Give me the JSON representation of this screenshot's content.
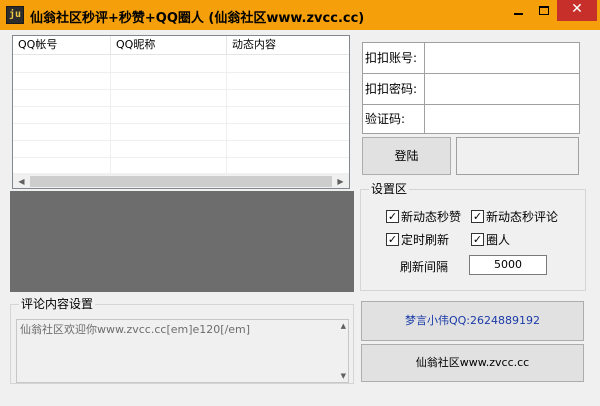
{
  "window": {
    "icon_text": "ju",
    "title": "仙翁社区秒评+秒赞+QQ圈人 (仙翁社区www.zvcc.cc)",
    "close_glyph": "✕"
  },
  "list": {
    "columns": [
      "QQ帐号",
      "QQ昵称",
      "动态内容"
    ],
    "rows": []
  },
  "comment_settings": {
    "group_title": "评论内容设置",
    "text": "仙翁社区欢迎你www.zvcc.cc[em]e120[/em]"
  },
  "login": {
    "account_label": "扣扣账号:",
    "password_label": "扣扣密码:",
    "captcha_label": "验证码:",
    "account_value": "",
    "password_value": "",
    "captcha_value": "",
    "login_button": "登陆"
  },
  "settings": {
    "group_title": "设置区",
    "options": [
      {
        "label": "新动态秒赞",
        "checked": true
      },
      {
        "label": "新动态秒评论",
        "checked": true
      },
      {
        "label": "定时刷新",
        "checked": true
      },
      {
        "label": "圈人",
        "checked": true
      }
    ],
    "interval_label": "刷新间隔",
    "interval_value": "5000"
  },
  "buttons": {
    "contact": "梦言小伟QQ:2624889192",
    "site": "仙翁社区www.zvcc.cc"
  },
  "colors": {
    "titlebar": "#f5a00b",
    "close": "#c7302a",
    "gray_panel": "#6d6d6d",
    "contact_text": "#1a3aa8"
  }
}
